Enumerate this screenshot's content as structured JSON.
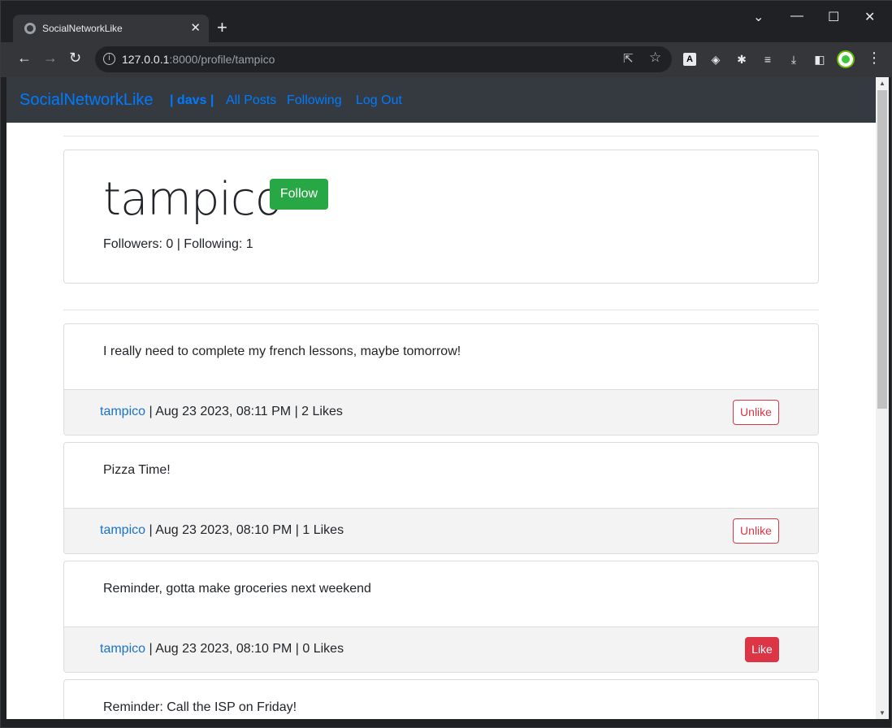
{
  "browser": {
    "tab_title": "SocialNetworkLike",
    "url_host": "127.0.0.1",
    "url_rest": ":8000/profile/tampico"
  },
  "navbar": {
    "brand": "SocialNetworkLike",
    "user": "| davs |",
    "links": [
      "All Posts",
      "Following",
      "Log Out"
    ]
  },
  "profile": {
    "username": "tampico",
    "follow_label": "Follow",
    "counts": "Followers: 0 | Following: 1"
  },
  "posts": [
    {
      "body": "I really need to complete my french lessons, maybe tomorrow!",
      "author": "tampico",
      "meta": " | Aug 23 2023, 08:11 PM | 2 Likes",
      "button": "Unlike"
    },
    {
      "body": "Pizza Time!",
      "author": "tampico",
      "meta": " | Aug 23 2023, 08:10 PM | 1 Likes",
      "button": "Unlike"
    },
    {
      "body": "Reminder, gotta make groceries next weekend",
      "author": "tampico",
      "meta": " | Aug 23 2023, 08:10 PM | 0 Likes",
      "button": "Like"
    },
    {
      "body": "Reminder: Call the ISP on Friday!"
    }
  ],
  "colors": {
    "navbar_bg": "#343a40",
    "link": "#007bff",
    "follow": "#28a745",
    "like": "#dc3545"
  }
}
